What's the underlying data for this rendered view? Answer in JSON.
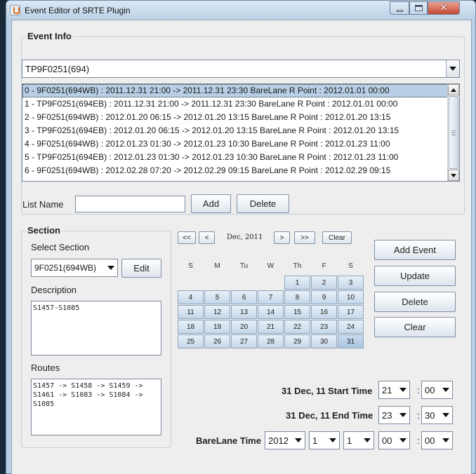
{
  "window": {
    "title": "Event Editor of SRTE Plugin"
  },
  "event_info": {
    "title": "Event Info",
    "train_select": "TP9F0251(694)",
    "events": [
      "0 - 9F0251(694WB) : 2011.12.31 21:00 -> 2011.12.31 23:30 BareLane R Point : 2012.01.01 00:00",
      "1 - TP9F0251(694EB) : 2011.12.31 21:00 -> 2011.12.31 23:30 BareLane R Point : 2012.01.01 00:00",
      "2 - 9F0251(694WB) : 2012.01.20 06:15 -> 2012.01.20 13:15 BareLane R Point : 2012.01.20 13:15",
      "3 - TP9F0251(694EB) : 2012.01.20 06:15 -> 2012.01.20 13:15 BareLane R Point : 2012.01.20 13:15",
      "4 - 9F0251(694WB) : 2012.01.23 01:30 -> 2012.01.23 10:30 BareLane R Point : 2012.01.23 11:00",
      "5 - TP9F0251(694EB) : 2012.01.23 01:30 -> 2012.01.23 10:30 BareLane R Point : 2012.01.23 11:00",
      "6 - 9F0251(694WB) : 2012.02.28 07:20 -> 2012.02.29 09:15 BareLane R Point : 2012.02.29 09:15"
    ],
    "list_name_label": "List Name",
    "list_name_value": "",
    "add_label": "Add",
    "delete_label": "Delete"
  },
  "section": {
    "title": "Section",
    "select_label": "Select Section",
    "select_value": "9F0251(694WB)",
    "edit_label": "Edit",
    "description_label": "Description",
    "description_value": "S1457-S1085",
    "routes_label": "Routes",
    "routes_value": "S1457 -> S1458 -> S1459 ->\nS1461 -> S1083 -> S1084 ->\nS1085"
  },
  "calendar": {
    "prev_year": "<<",
    "prev_month": "<",
    "month_label": "Dec, 2011",
    "next_month": ">",
    "next_year": ">>",
    "clear": "Clear",
    "weekdays": [
      "S",
      "M",
      "Tu",
      "W",
      "Th",
      "F",
      "S"
    ],
    "first_weekday_index": 4,
    "days": [
      "1",
      "2",
      "3",
      "4",
      "5",
      "6",
      "7",
      "8",
      "9",
      "10",
      "11",
      "12",
      "13",
      "14",
      "15",
      "16",
      "17",
      "18",
      "19",
      "20",
      "21",
      "22",
      "23",
      "24",
      "25",
      "26",
      "27",
      "28",
      "29",
      "30",
      "31"
    ],
    "selected_day": "31"
  },
  "actions": {
    "add_event": "Add Event",
    "update": "Update",
    "delete": "Delete",
    "clear": "Clear"
  },
  "times": {
    "start_date": "31 Dec, 11",
    "start_label": "Start Time",
    "start_hour": "21",
    "start_min": "00",
    "end_date": "31 Dec, 11",
    "end_label": "End Time",
    "end_hour": "23",
    "end_min": "30",
    "barelane_label": "BareLane Time",
    "bl_year": "2012",
    "bl_month": "1",
    "bl_day": "1",
    "bl_hour": "00",
    "bl_min": "00",
    "colon": ":"
  }
}
